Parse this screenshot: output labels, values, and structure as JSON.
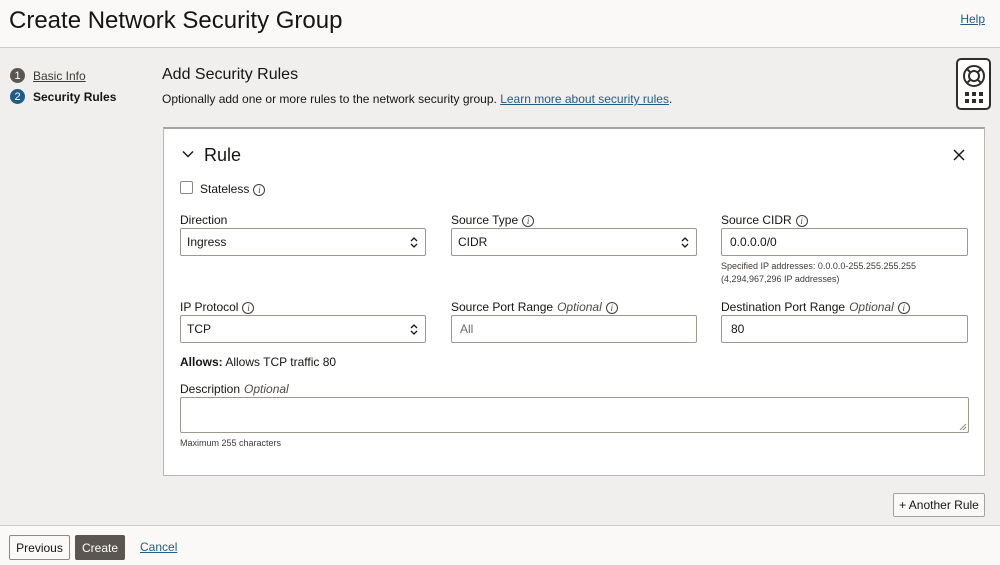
{
  "header": {
    "title": "Create Network Security Group",
    "help": "Help"
  },
  "steps": [
    {
      "num": "1",
      "label": "Basic Info"
    },
    {
      "num": "2",
      "label": "Security Rules"
    }
  ],
  "section": {
    "title": "Add Security Rules",
    "description": "Optionally add one or more rules to the network security group.",
    "learn_more": "Learn more about security rules",
    "period": "."
  },
  "rule": {
    "title": "Rule",
    "stateless_label": "Stateless",
    "direction": {
      "label": "Direction",
      "value": "Ingress"
    },
    "source_type": {
      "label": "Source Type",
      "value": "CIDR"
    },
    "source_cidr": {
      "label": "Source CIDR",
      "value": "0.0.0.0/0",
      "hint_line1": "Specified IP addresses: 0.0.0.0-255.255.255.255",
      "hint_line2": "(4,294,967,296 IP addresses)"
    },
    "ip_protocol": {
      "label": "IP Protocol",
      "value": "TCP"
    },
    "source_port": {
      "label": "Source Port Range",
      "optional": "Optional",
      "placeholder": "All"
    },
    "dest_port": {
      "label": "Destination Port Range",
      "optional": "Optional",
      "value": "80"
    },
    "allows_label": "Allows:",
    "allows_text": "Allows TCP traffic 80",
    "description": {
      "label": "Description",
      "optional": "Optional",
      "hint": "Maximum 255 characters"
    }
  },
  "another_rule": "+ Another Rule",
  "footer": {
    "previous": "Previous",
    "create": "Create",
    "cancel": "Cancel"
  },
  "info_glyph": "i"
}
